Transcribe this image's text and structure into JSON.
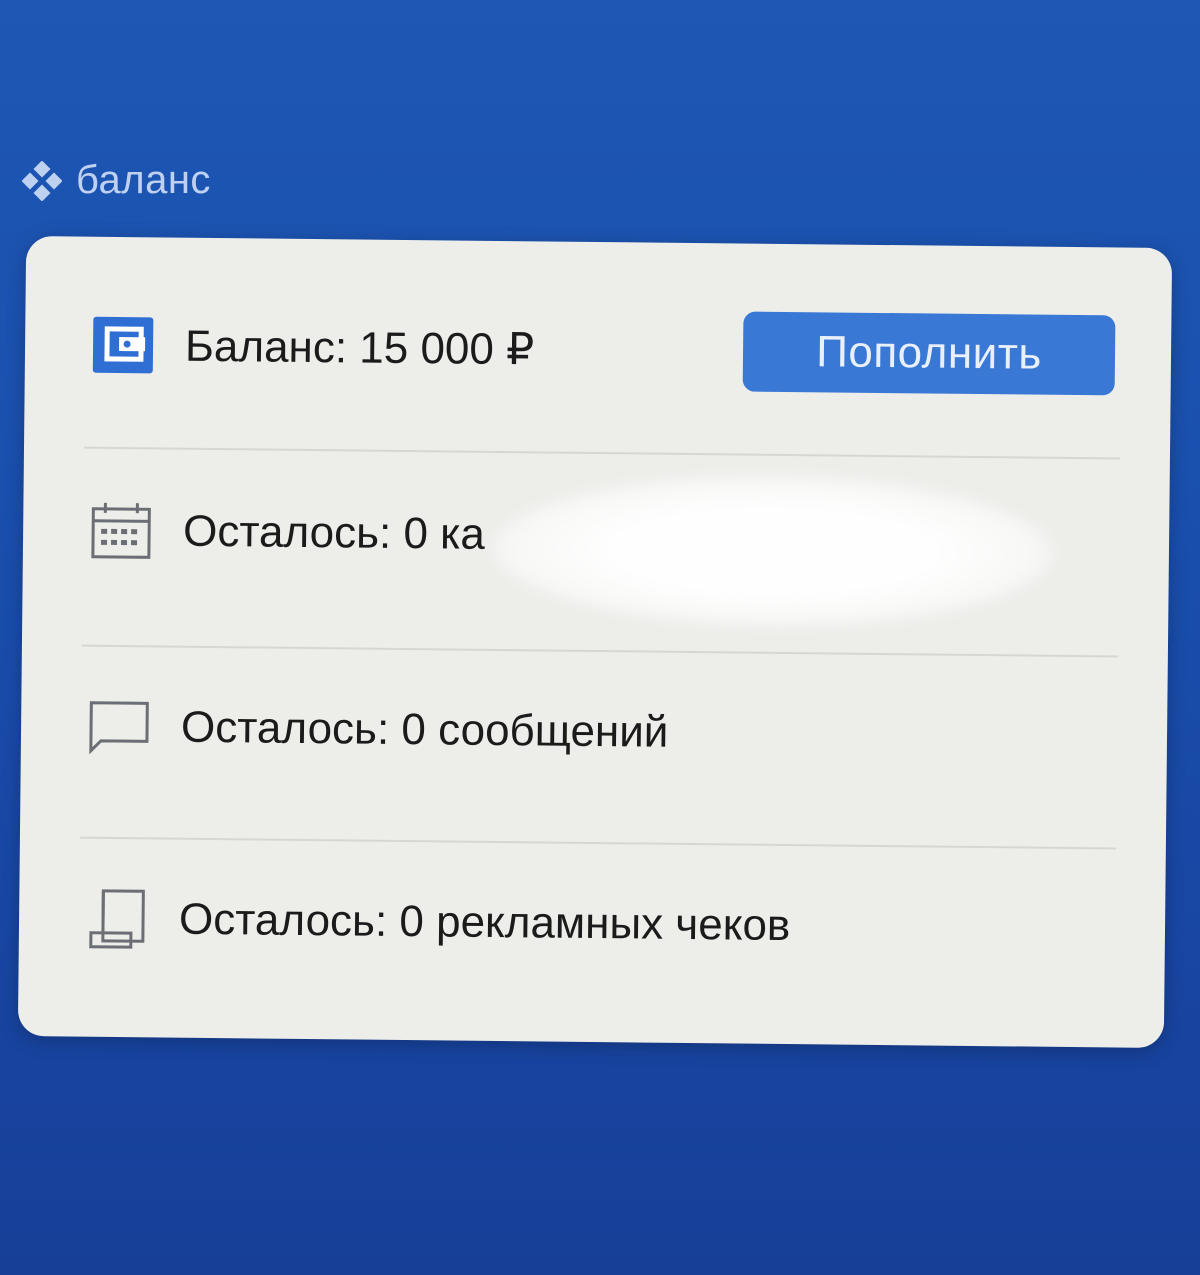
{
  "section": {
    "title": "баланс",
    "icon": "diamond-icon"
  },
  "balance": {
    "label": "Баланс: 15 000 ₽",
    "icon": "wallet-icon",
    "topup_label": "Пополнить",
    "accent": "#3a78d6"
  },
  "rows": [
    {
      "label": "Осталось: 0 ка",
      "icon": "calendar-icon"
    },
    {
      "label": "Осталось: 0 сообщений",
      "icon": "message-icon"
    },
    {
      "label": "Осталось: 0 рекламных чеков",
      "icon": "receipt-icon"
    }
  ]
}
